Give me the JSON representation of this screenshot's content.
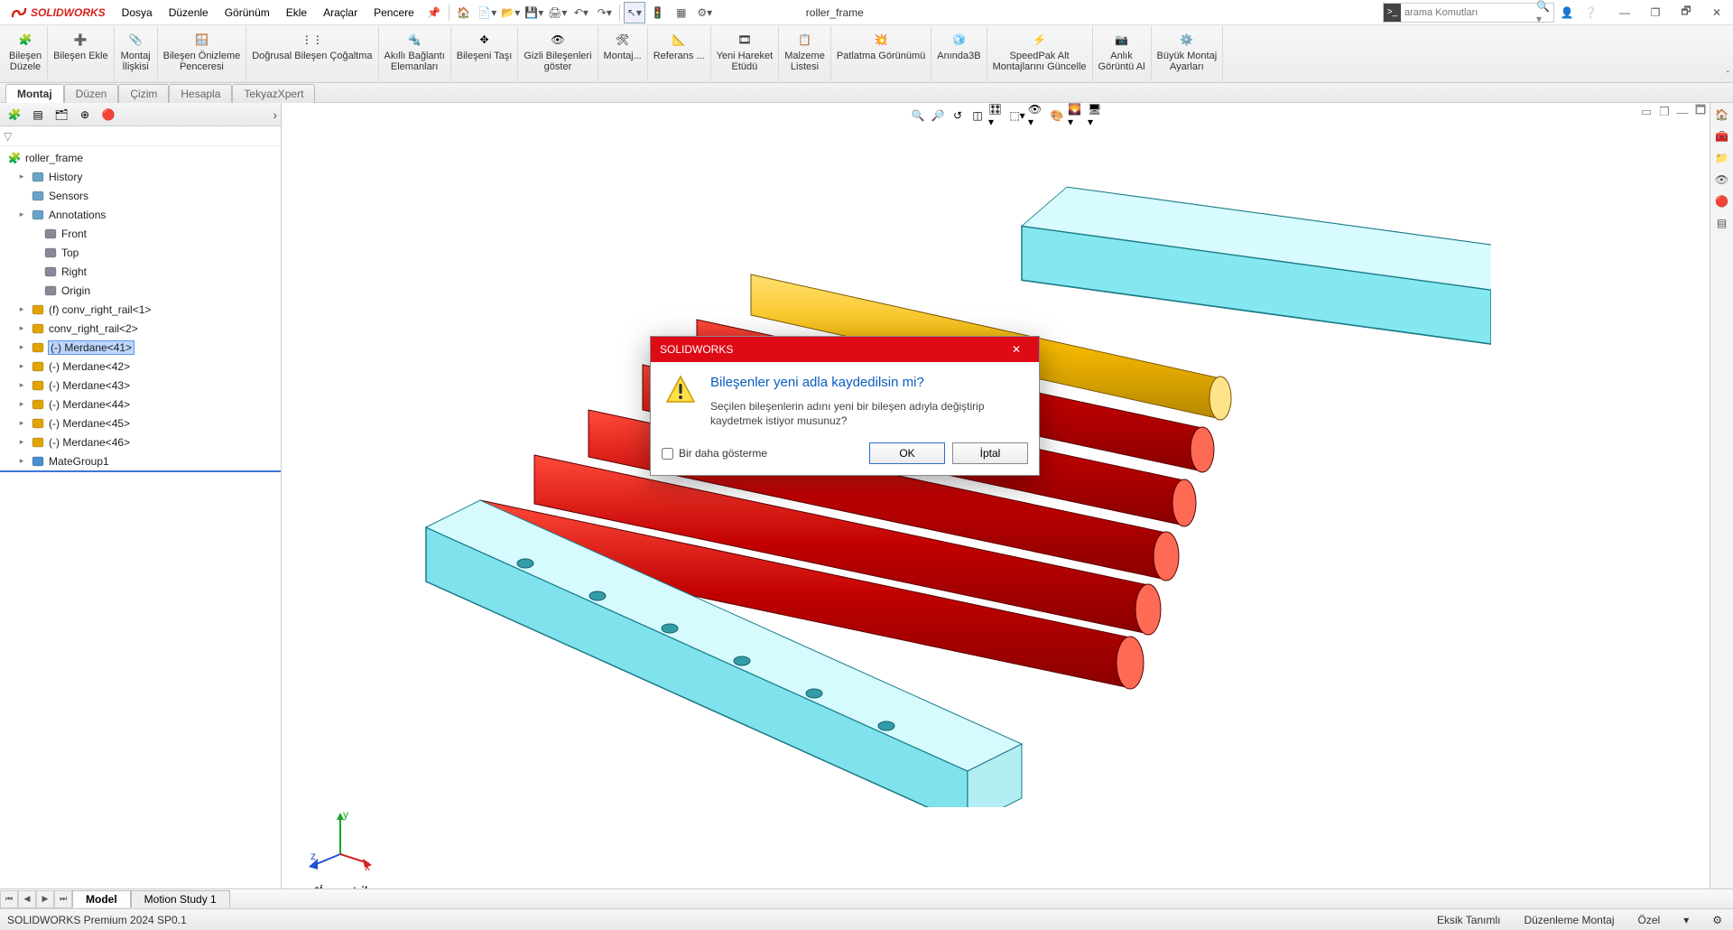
{
  "app": {
    "brand": "SOLIDWORKS",
    "doc_name": "roller_frame"
  },
  "menu": {
    "items": [
      "Dosya",
      "Düzenle",
      "Görünüm",
      "Ekle",
      "Araçlar",
      "Pencere"
    ]
  },
  "search": {
    "placeholder": "arama Komutları"
  },
  "ribbon": {
    "groups": [
      {
        "label": "Bileşen\nDüzele"
      },
      {
        "label": "Bileşen Ekle"
      },
      {
        "label": "Montaj\nİlişkisi"
      },
      {
        "label": "Bileşen Önizleme\nPenceresi"
      },
      {
        "label": "Doğrusal Bileşen Çoğaltma"
      },
      {
        "label": "Akıllı Bağlantı\nElemanları"
      },
      {
        "label": "Bileşeni Taşı"
      },
      {
        "label": "Gizli Bileşenleri\ngöster"
      },
      {
        "label": "Montaj..."
      },
      {
        "label": "Referans ..."
      },
      {
        "label": "Yeni Hareket\nEtüdü"
      },
      {
        "label": "Malzeme\nListesi"
      },
      {
        "label": "Patlatma Görünümü"
      },
      {
        "label": "Anında3B"
      },
      {
        "label": "SpeedPak Alt\nMontajlarını Güncelle"
      },
      {
        "label": "Anlık\nGörüntü Al"
      },
      {
        "label": "Büyük Montaj\nAyarları"
      }
    ],
    "tabs": [
      "Montaj",
      "Düzen",
      "Çizim",
      "Hesapla",
      "TekyazXpert"
    ]
  },
  "tree": {
    "root": "roller_frame",
    "nodes": [
      {
        "label": "History",
        "indent": 1,
        "color": "#6aa3c9",
        "twist": "▸"
      },
      {
        "label": "Sensors",
        "indent": 1,
        "color": "#6aa3c9"
      },
      {
        "label": "Annotations",
        "indent": 1,
        "color": "#6aa3c9",
        "twist": "▸"
      },
      {
        "label": "Front",
        "indent": 2,
        "color": "#889"
      },
      {
        "label": "Top",
        "indent": 2,
        "color": "#889"
      },
      {
        "label": "Right",
        "indent": 2,
        "color": "#889"
      },
      {
        "label": "Origin",
        "indent": 2,
        "color": "#889"
      },
      {
        "label": "(f) conv_right_rail<1>",
        "indent": 1,
        "color": "#e2a400",
        "twist": "▸"
      },
      {
        "label": "conv_right_rail<2>",
        "indent": 1,
        "color": "#e2a400",
        "twist": "▸"
      },
      {
        "label": "(-) Merdane<41>",
        "indent": 1,
        "color": "#e2a400",
        "twist": "▸",
        "selected": true
      },
      {
        "label": "(-) Merdane<42>",
        "indent": 1,
        "color": "#e2a400",
        "twist": "▸"
      },
      {
        "label": "(-) Merdane<43>",
        "indent": 1,
        "color": "#e2a400",
        "twist": "▸"
      },
      {
        "label": "(-) Merdane<44>",
        "indent": 1,
        "color": "#e2a400",
        "twist": "▸"
      },
      {
        "label": "(-) Merdane<45>",
        "indent": 1,
        "color": "#e2a400",
        "twist": "▸"
      },
      {
        "label": "(-) Merdane<46>",
        "indent": 1,
        "color": "#e2a400",
        "twist": "▸"
      },
      {
        "label": "MateGroup1",
        "indent": 1,
        "color": "#4890d0",
        "twist": "▸"
      }
    ]
  },
  "bottom_tabs": {
    "model": "Model",
    "motion": "Motion Study 1"
  },
  "view": {
    "iso_label": "*İzometrik"
  },
  "statusbar": {
    "product": "SOLIDWORKS Premium 2024 SP0.1",
    "s1": "Eksik Tanımlı",
    "s2": "Düzenleme Montaj",
    "s3": "Özel"
  },
  "dialog": {
    "title": "SOLIDWORKS",
    "headline": "Bileşenler yeni adla kaydedilsin mi?",
    "sub": "Seçilen bileşenlerin adını yeni bir bileşen adıyla değiştirip kaydetmek istiyor musunuz?",
    "dont_show": "Bir daha gösterme",
    "ok": "OK",
    "cancel": "İptal"
  }
}
